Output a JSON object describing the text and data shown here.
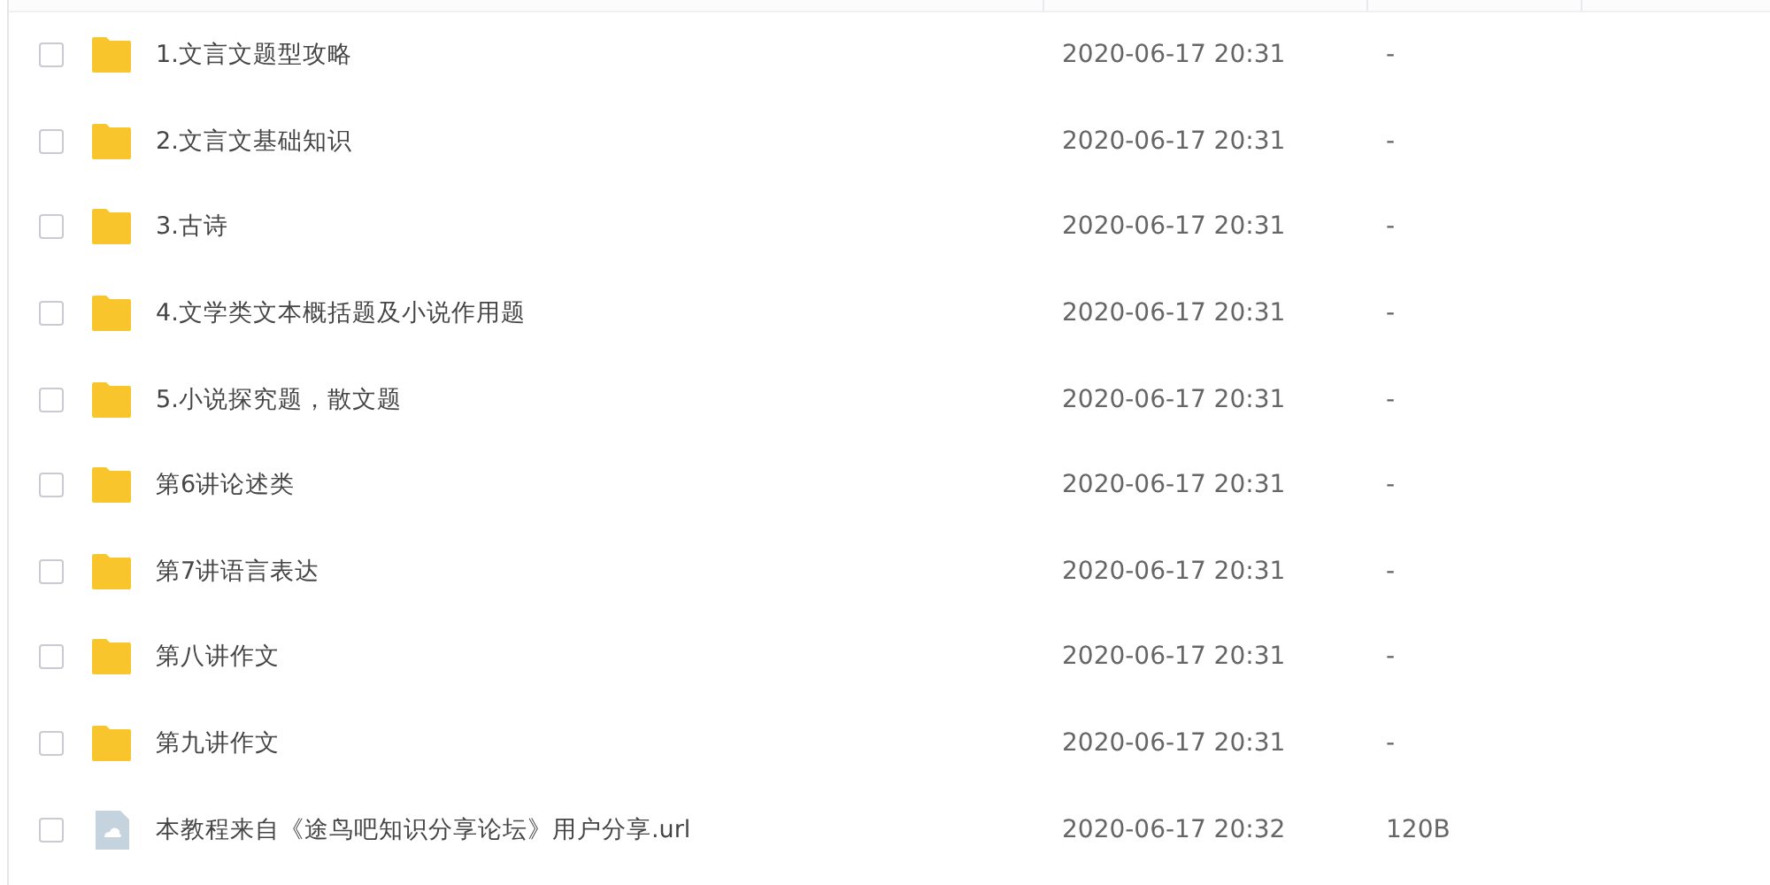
{
  "files": [
    {
      "kind": "folder",
      "name": "1.文言文题型攻略",
      "modified": "2020-06-17 20:31",
      "size": "-",
      "checked": false
    },
    {
      "kind": "folder",
      "name": "2.文言文基础知识",
      "modified": "2020-06-17 20:31",
      "size": "-",
      "checked": false
    },
    {
      "kind": "folder",
      "name": "3.古诗",
      "modified": "2020-06-17 20:31",
      "size": "-",
      "checked": false
    },
    {
      "kind": "folder",
      "name": "4.文学类文本概括题及小说作用题",
      "modified": "2020-06-17 20:31",
      "size": "-",
      "checked": false
    },
    {
      "kind": "folder",
      "name": "5.小说探究题，散文题",
      "modified": "2020-06-17 20:31",
      "size": "-",
      "checked": false
    },
    {
      "kind": "folder",
      "name": "第6讲论述类",
      "modified": "2020-06-17 20:31",
      "size": "-",
      "checked": false
    },
    {
      "kind": "folder",
      "name": "第7讲语言表达",
      "modified": "2020-06-17 20:31",
      "size": "-",
      "checked": false
    },
    {
      "kind": "folder",
      "name": "第八讲作文",
      "modified": "2020-06-17 20:31",
      "size": "-",
      "checked": false
    },
    {
      "kind": "folder",
      "name": "第九讲作文",
      "modified": "2020-06-17 20:31",
      "size": "-",
      "checked": false
    },
    {
      "kind": "link",
      "name": "本教程来自《途鸟吧知识分享论坛》用户分享.url",
      "modified": "2020-06-17 20:32",
      "size": "120B",
      "checked": false
    }
  ]
}
